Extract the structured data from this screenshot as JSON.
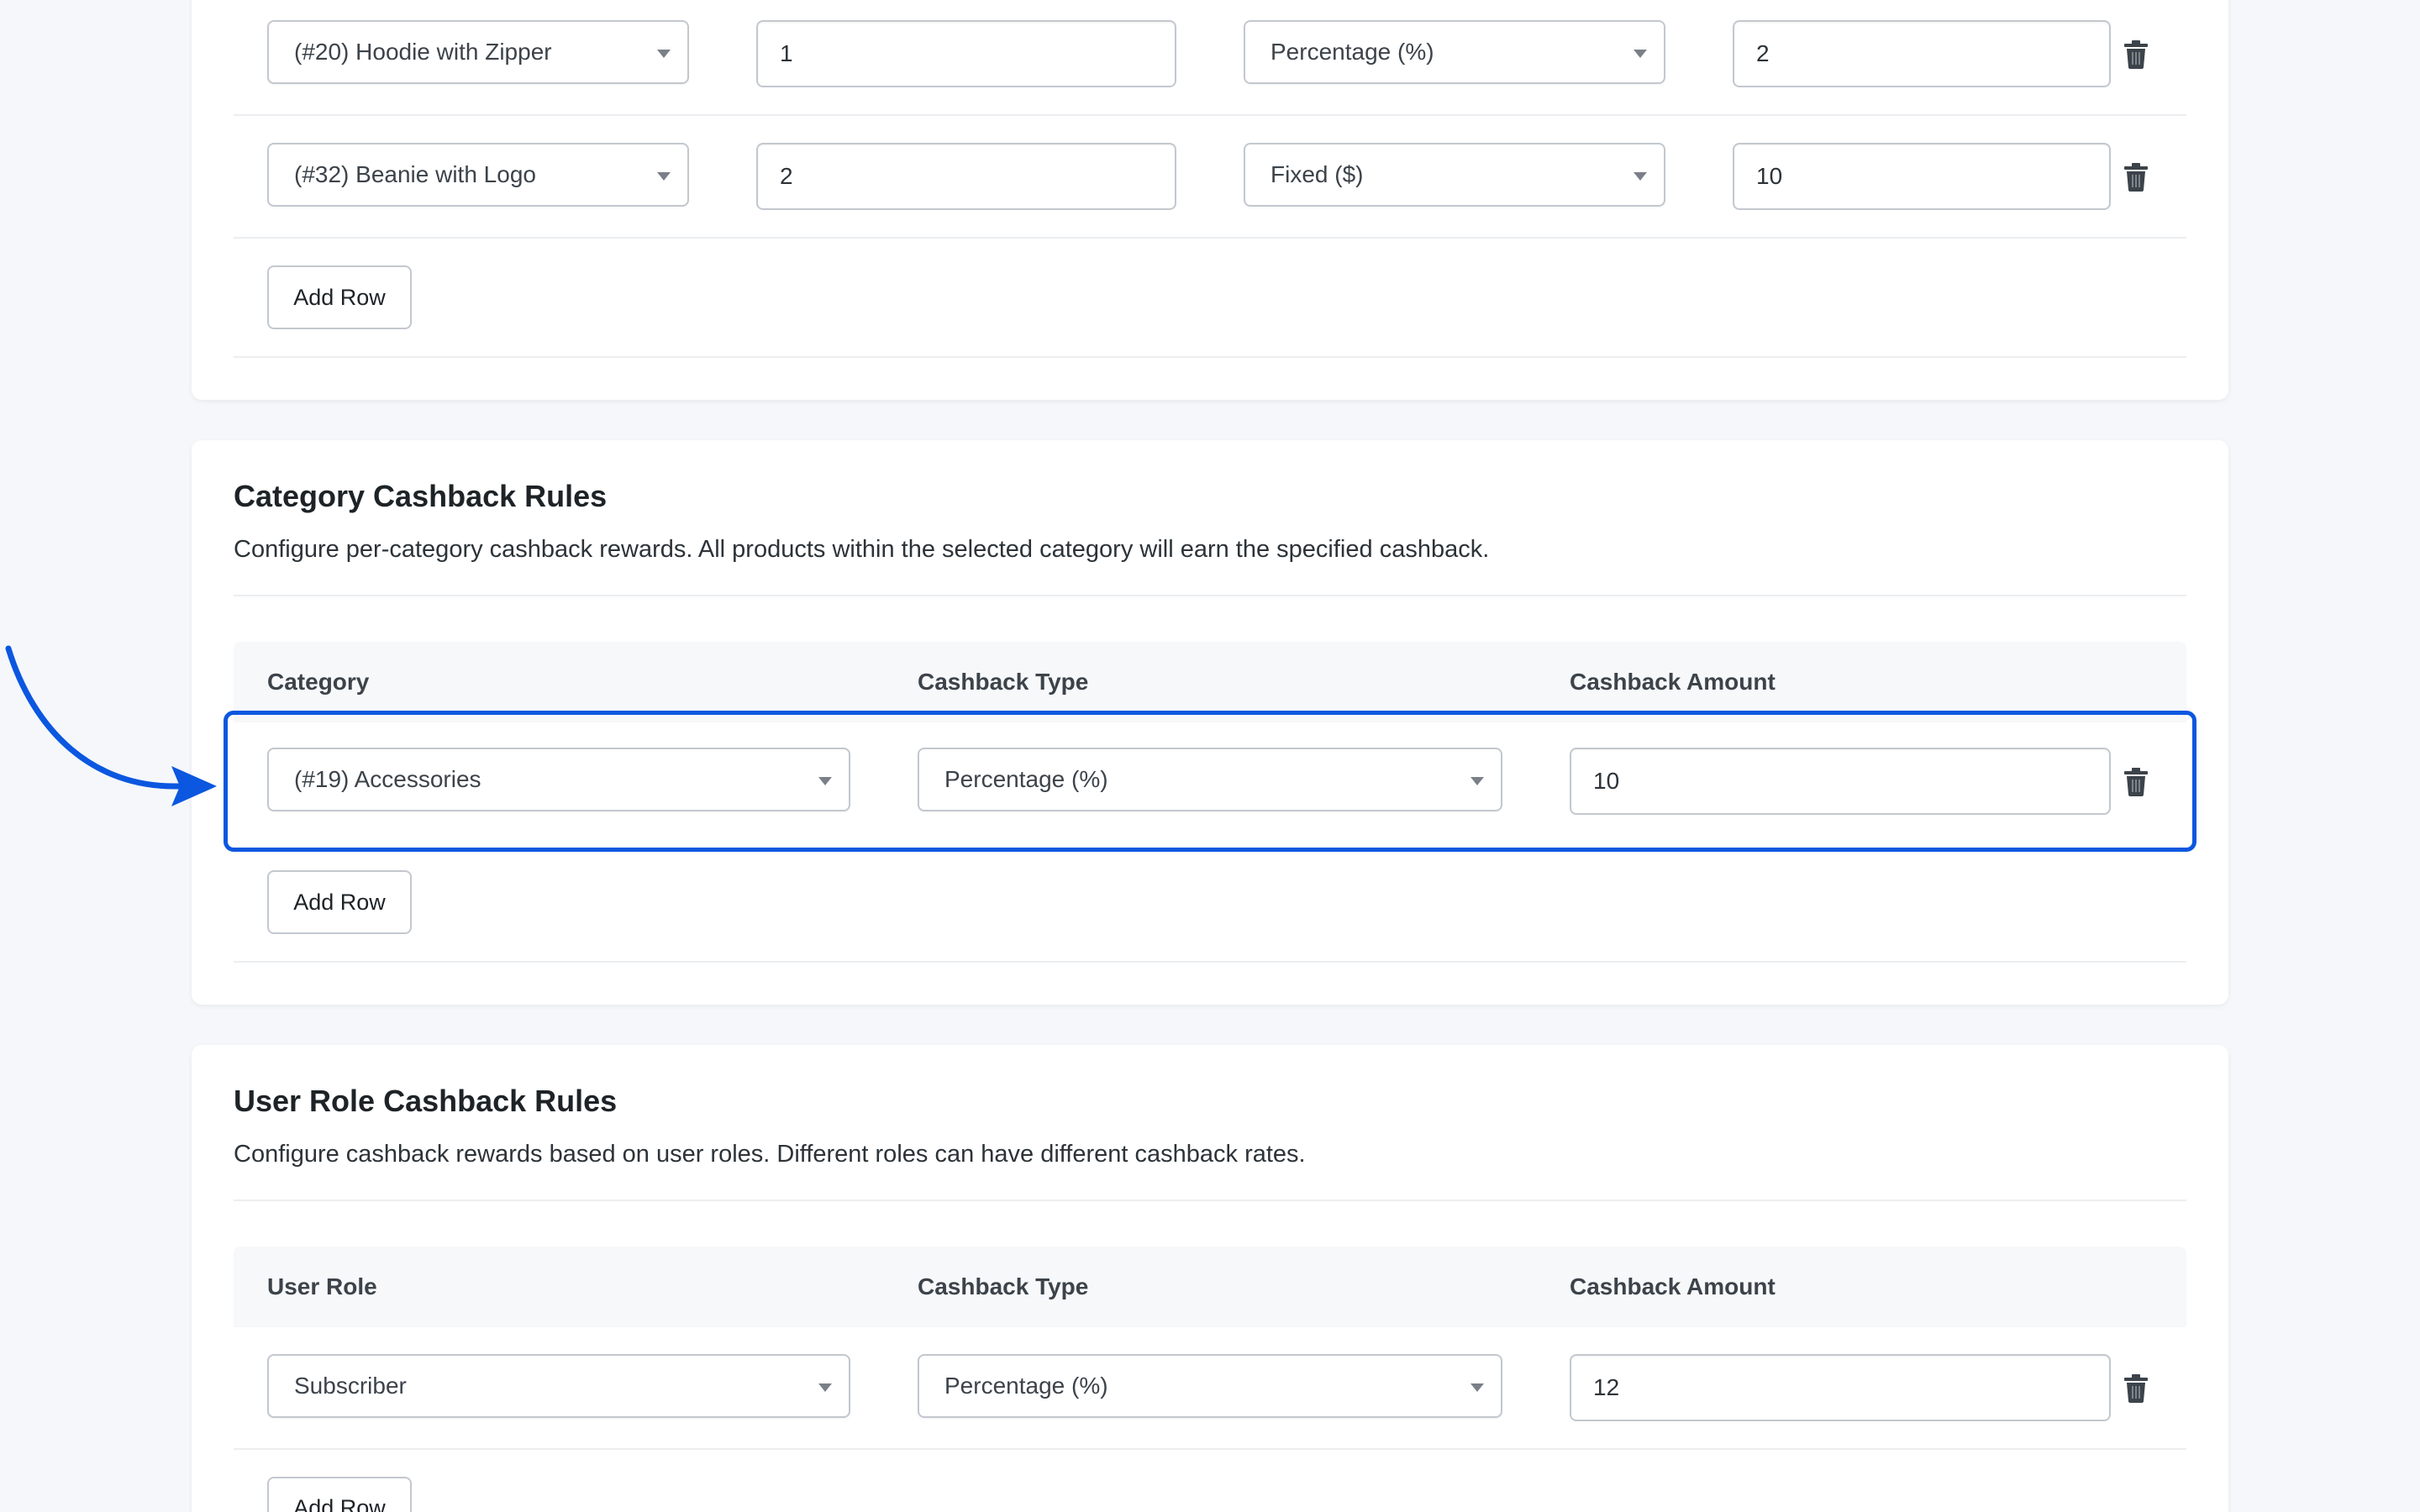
{
  "product_rules": {
    "rows": [
      {
        "product": "(#20) Hoodie with Zipper",
        "quantity": "1",
        "type": "Percentage (%)",
        "amount": "2"
      },
      {
        "product": "(#32) Beanie with Logo",
        "quantity": "2",
        "type": "Fixed ($)",
        "amount": "10"
      }
    ],
    "add_row_label": "Add Row"
  },
  "category_rules": {
    "title": "Category Cashback Rules",
    "description": "Configure per-category cashback rewards. All products within the selected category will earn the specified cashback.",
    "headers": {
      "category": "Category",
      "type": "Cashback Type",
      "amount": "Cashback Amount"
    },
    "rows": [
      {
        "category": "(#19) Accessories",
        "type": "Percentage (%)",
        "amount": "10"
      }
    ],
    "add_row_label": "Add Row"
  },
  "role_rules": {
    "title": "User Role Cashback Rules",
    "description": "Configure cashback rewards based on user roles. Different roles can have different cashback rates.",
    "headers": {
      "role": "User Role",
      "type": "Cashback Type",
      "amount": "Cashback Amount"
    },
    "rows": [
      {
        "role": "Subscriber",
        "type": "Percentage (%)",
        "amount": "12"
      }
    ],
    "add_row_label": "Add Row"
  },
  "colors": {
    "annotation": "#0b57e0",
    "trash_icon": "#3c434a"
  },
  "icons": {
    "delete": "trash-icon",
    "dropdown": "chevron-down-icon",
    "annotation": "curved-arrow-icon"
  }
}
